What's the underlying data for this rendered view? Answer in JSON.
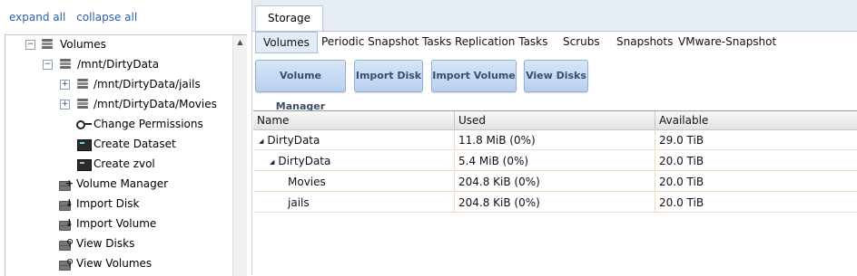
{
  "left": {
    "expand_all": "expand all",
    "collapse_all": "collapse all",
    "tree": [
      {
        "label": "Volumes",
        "toggle": "−",
        "icon": "drive-icon"
      },
      {
        "label": "/mnt/DirtyData",
        "toggle": "−",
        "icon": "drive-icon"
      },
      {
        "label": "/mnt/DirtyData/jails",
        "toggle": "+",
        "icon": "drive-icon"
      },
      {
        "label": "/mnt/DirtyData/Movies",
        "toggle": "+",
        "icon": "drive-icon"
      },
      {
        "label": "Change Permissions",
        "icon": "key-icon"
      },
      {
        "label": "Create Dataset",
        "icon": "terminal-icon"
      },
      {
        "label": "Create zvol",
        "icon": "terminal-icon"
      },
      {
        "label": "Volume Manager",
        "icon": "volume-manager-icon"
      },
      {
        "label": "Import Disk",
        "icon": "import-disk-icon"
      },
      {
        "label": "Import Volume",
        "icon": "import-volume-icon"
      },
      {
        "label": "View Disks",
        "icon": "view-disks-icon"
      },
      {
        "label": "View Volumes",
        "icon": "view-volumes-icon"
      }
    ]
  },
  "top_tab": "Storage",
  "subtabs": [
    "Volumes",
    "Periodic Snapshot Tasks",
    "Replication Tasks",
    "Scrubs",
    "Snapshots",
    "VMware-Snapshot"
  ],
  "active_subtab": "Volumes",
  "buttons": [
    "Volume Manager",
    "Import Disk",
    "Import Volume",
    "View Disks"
  ],
  "grid": {
    "columns": [
      "Name",
      "Used",
      "Available"
    ],
    "rows": [
      {
        "name": "DirtyData",
        "used": "11.8 MiB (0%)",
        "available": "29.0 TiB",
        "expand": "▲"
      },
      {
        "name": "DirtyData",
        "used": "5.4 MiB (0%)",
        "available": "20.0 TiB",
        "expand": "▲"
      },
      {
        "name": "Movies",
        "used": "204.8 KiB (0%)",
        "available": "20.0 TiB"
      },
      {
        "name": "jails",
        "used": "204.8 KiB (0%)",
        "available": "20.0 TiB"
      }
    ]
  }
}
